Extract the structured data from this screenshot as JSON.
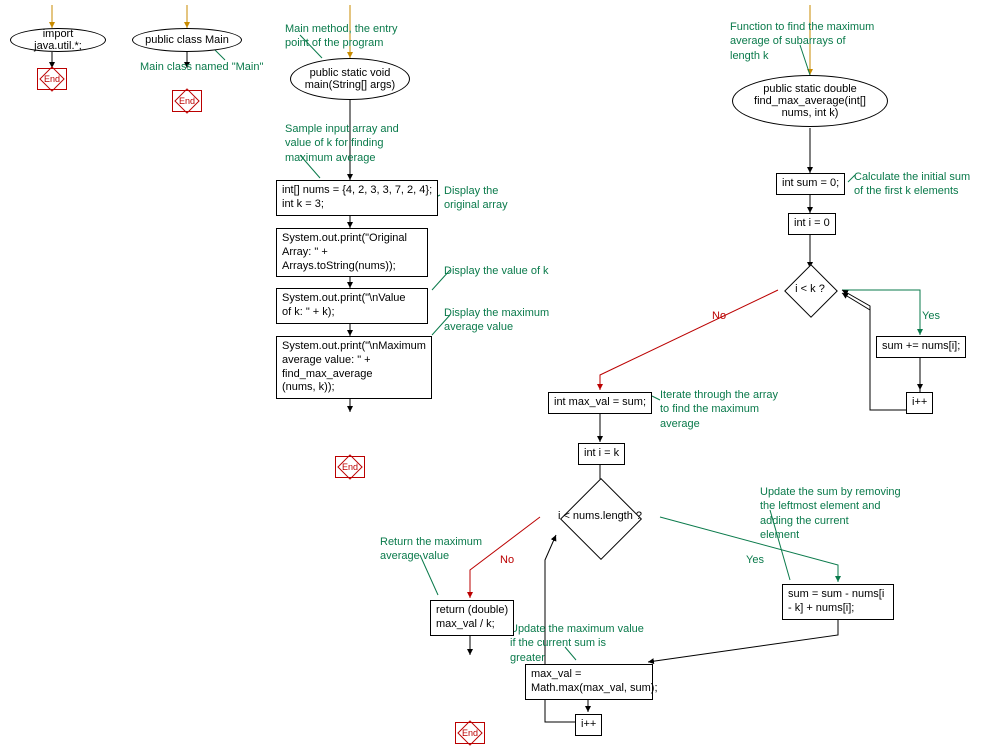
{
  "nodes": {
    "import_stmt": "import java.util.*;",
    "class_decl": "public class Main",
    "main_decl": "public static void\nmain(String[] args)",
    "nums_decl": "int[] nums = {4, 2, 3, 3, 7, 2, 4};\nint k = 3;",
    "print_orig": "System.out.print(\"Original\nArray: \" +\nArrays.toString(nums));",
    "print_k": "System.out.print(\"\\nValue\nof k: \" + k);",
    "print_max": "System.out.print(\"\\nMaximum\naverage value: \" +\nfind_max_average\n(nums, k));",
    "func_decl": "public static double\nfind_max_average(int[]\nnums, int k)",
    "sum_init": "int sum = 0;",
    "i_init_0": "int i = 0",
    "cond1": "i < k ?",
    "sum_add": "sum += nums[i];",
    "ipp1": "i++",
    "maxval_init": "int max_val = sum;",
    "i_init_k": "int i = k",
    "cond2": "i < nums.length ?",
    "sum_slide": "sum = sum - nums[i\n- k] + nums[i];",
    "maxval_upd": "max_val =\nMath.max(max_val, sum);",
    "ipp2": "i++",
    "ret": "return (double)\nmax_val / k;",
    "end_label": "End"
  },
  "comments": {
    "c_class": "Main class named \"Main\"",
    "c_main": "Main method, the entry\npoint of the program",
    "c_sample": "Sample input array and\nvalue of k for finding\nmaximum average",
    "c_disp_orig": "Display the\noriginal array",
    "c_disp_k": "Display the value of k",
    "c_disp_max": "Display the maximum\naverage value",
    "c_func": "Function to find the maximum\naverage of subarrays of\nlength k",
    "c_calc_init": "Calculate the initial sum\nof the first k elements",
    "c_iterate": "Iterate through the array\nto find the maximum\naverage",
    "c_upd_sum": "Update the sum by removing\nthe leftmost element and\nadding the current\nelement",
    "c_upd_max": "Update the maximum value\nif the current sum is\ngreater",
    "c_ret": "Return the maximum\naverage value"
  },
  "labels": {
    "yes": "Yes",
    "no": "No"
  }
}
